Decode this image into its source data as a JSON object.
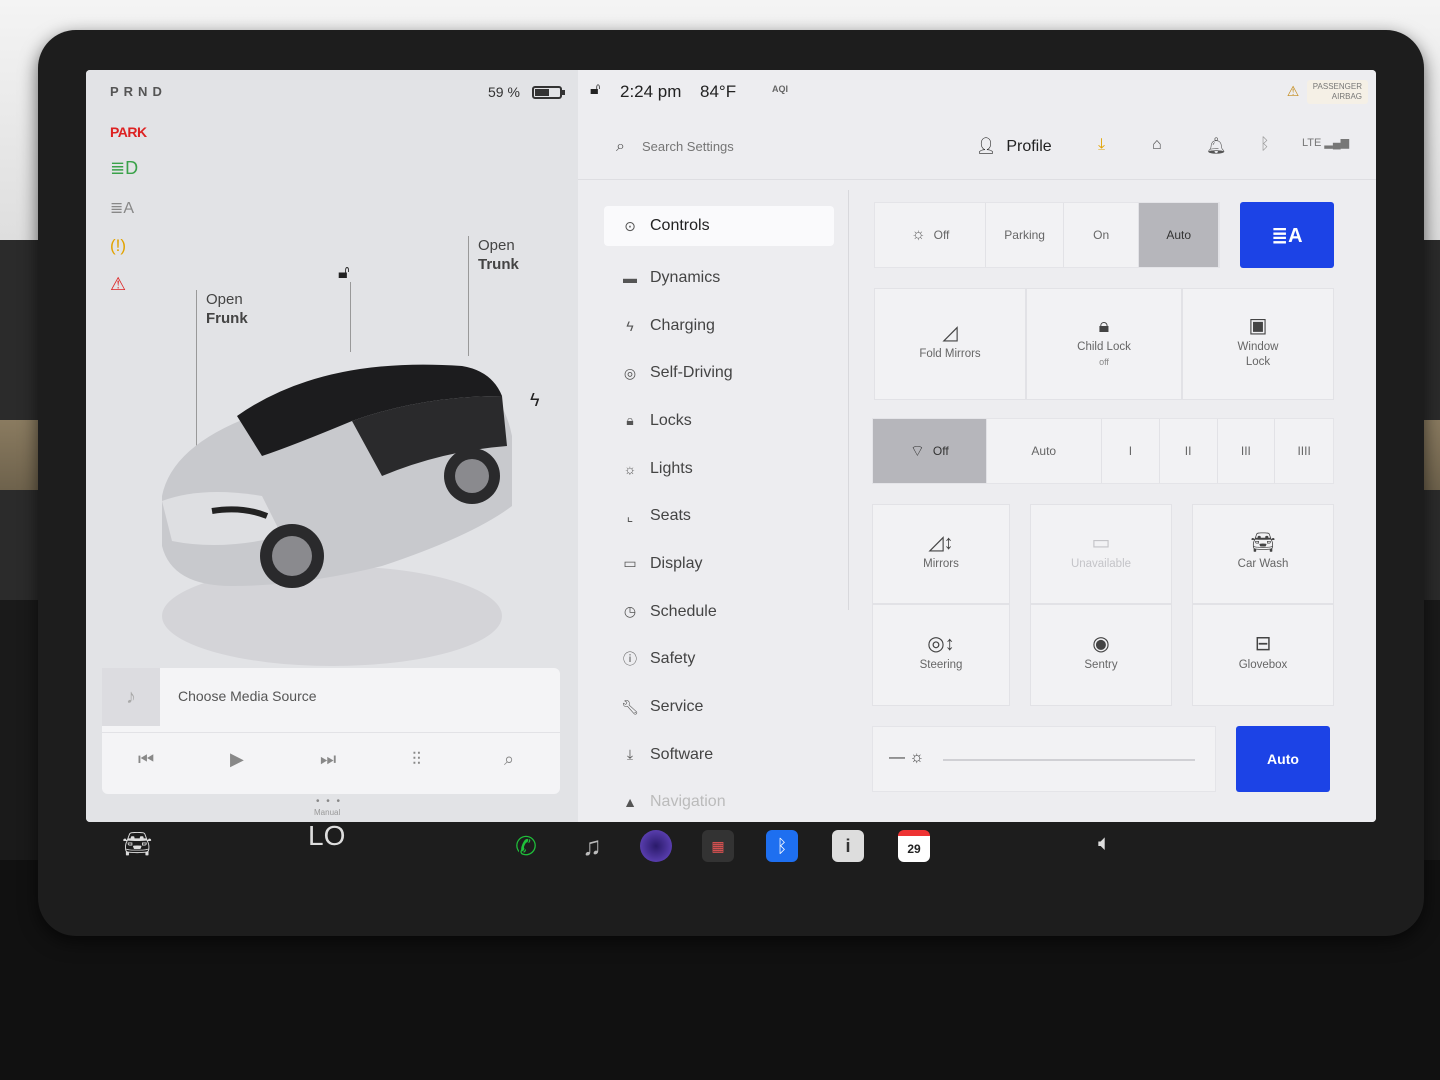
{
  "status": {
    "gears": "PRND",
    "park": "PARK",
    "battery_percent": "59 %",
    "battery_level": 0.59,
    "time": "2:24 pm",
    "temperature": "84°F",
    "aqi": "AQI",
    "airbag_line1": "PASSENGER",
    "airbag_line2": "AIRBAG"
  },
  "car": {
    "frunk_line1": "Open",
    "frunk_line2": "Frunk",
    "trunk_line1": "Open",
    "trunk_line2": "Trunk"
  },
  "media": {
    "source": "Choose Media Source"
  },
  "search": {
    "placeholder": "Search Settings"
  },
  "profile": {
    "label": "Profile"
  },
  "nav": {
    "items": [
      {
        "label": "Controls",
        "icon": "toggle-icon"
      },
      {
        "label": "Dynamics",
        "icon": "car-icon"
      },
      {
        "label": "Charging",
        "icon": "bolt-icon"
      },
      {
        "label": "Self-Driving",
        "icon": "steering-wheel-icon"
      },
      {
        "label": "Locks",
        "icon": "lock-icon"
      },
      {
        "label": "Lights",
        "icon": "sun-icon"
      },
      {
        "label": "Seats",
        "icon": "seat-icon"
      },
      {
        "label": "Display",
        "icon": "display-icon"
      },
      {
        "label": "Schedule",
        "icon": "clock-icon"
      },
      {
        "label": "Safety",
        "icon": "warning-icon"
      },
      {
        "label": "Service",
        "icon": "wrench-icon"
      },
      {
        "label": "Software",
        "icon": "download-icon"
      },
      {
        "label": "Navigation",
        "icon": "navigation-icon"
      }
    ]
  },
  "lights": {
    "off": "Off",
    "parking": "Parking",
    "on": "On",
    "auto": "Auto",
    "selected": "Auto"
  },
  "tiles_row1": {
    "fold_mirrors": "Fold Mirrors",
    "child_lock": "Child Lock",
    "child_lock_state": "off",
    "window_lock_line1": "Window",
    "window_lock_line2": "Lock"
  },
  "wipers": {
    "off": "Off",
    "auto": "Auto",
    "s1": "I",
    "s2": "II",
    "s3": "III",
    "s4": "IIII",
    "selected": "Off"
  },
  "tiles_row3": {
    "mirrors": "Mirrors",
    "unavailable": "Unavailable",
    "car_wash": "Car Wash"
  },
  "tiles_row4": {
    "steering": "Steering",
    "sentry": "Sentry",
    "glovebox": "Glovebox"
  },
  "brightness": {
    "auto": "Auto",
    "level": 0
  },
  "taskbar": {
    "climate_mode": "Manual",
    "climate_value": "LO",
    "calendar_day": "29"
  },
  "colors": {
    "accent_blue": "#1c43e6",
    "park_red": "#dd2222",
    "headlight_green": "#3aa24a",
    "tpms_amber": "#e2a300",
    "phone_green": "#1fbf3a",
    "bluetooth_blue": "#1e6ff0"
  }
}
